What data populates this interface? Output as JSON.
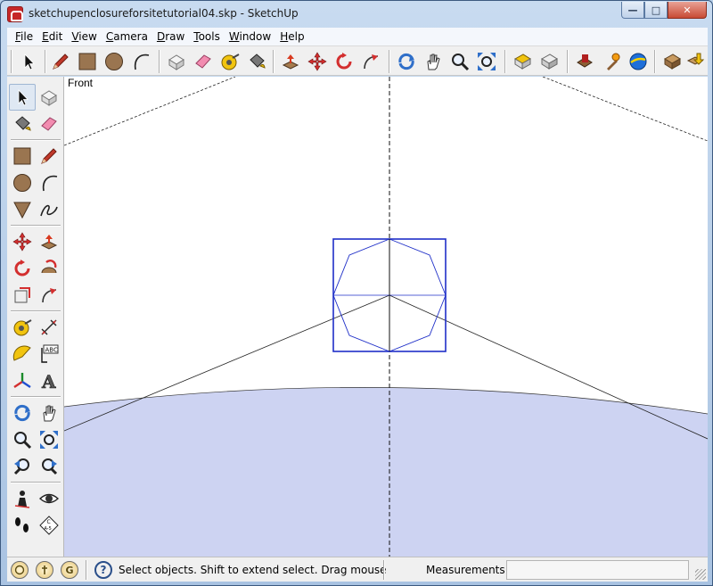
{
  "window": {
    "title": "sketchupenclosureforsitetutorial04.skp - SketchUp",
    "minimize_label": "—",
    "maximize_label": "□",
    "close_label": "✕"
  },
  "menu": [
    {
      "id": "file",
      "label": "File",
      "accel": "F",
      "rest": "ile"
    },
    {
      "id": "edit",
      "label": "Edit",
      "accel": "E",
      "rest": "dit"
    },
    {
      "id": "view",
      "label": "View",
      "accel": "V",
      "rest": "iew"
    },
    {
      "id": "camera",
      "label": "Camera",
      "accel": "C",
      "rest": "amera"
    },
    {
      "id": "draw",
      "label": "Draw",
      "accel": "D",
      "rest": "raw"
    },
    {
      "id": "tools",
      "label": "Tools",
      "accel": "T",
      "rest": "ools"
    },
    {
      "id": "window",
      "label": "Window",
      "accel": "W",
      "rest": "indow"
    },
    {
      "id": "help",
      "label": "Help",
      "accel": "H",
      "rest": "elp"
    }
  ],
  "viewport": {
    "view_name": "Front",
    "ground_color": "#cdd3f2",
    "sky_color": "#ffffff",
    "geometry_color": "#1f2fc8"
  },
  "statusbar": {
    "geo_icon": "G",
    "hint": "Select objects. Shift to extend select. Drag mouse",
    "measurements_label": "Measurements",
    "measurements_value": ""
  },
  "icons": {
    "toolbar": [
      "select-icon",
      "pencil-icon",
      "rectangle-icon",
      "circle-icon",
      "arc-icon",
      "make-component-icon",
      "eraser-icon",
      "tape-measure-icon",
      "paint-bucket-icon",
      "push-pull-icon",
      "move-icon",
      "rotate-icon",
      "follow-me-icon",
      "orbit-icon",
      "pan-icon",
      "zoom-icon",
      "zoom-extents-icon",
      "previous-view-icon",
      "next-view-icon",
      "warehouse-icon",
      "extension-icon",
      "google-earth-icon",
      "photo-textures-icon",
      "import-icon"
    ],
    "accent": "#c62828"
  }
}
